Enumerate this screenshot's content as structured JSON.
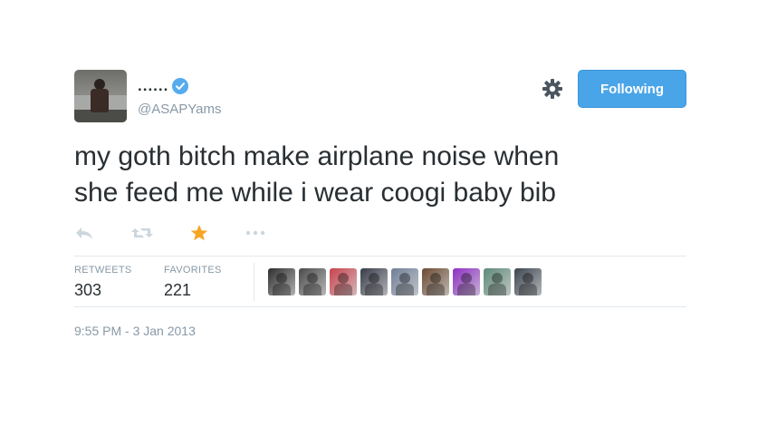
{
  "user": {
    "display_name": "......",
    "handle": "@ASAPYams",
    "verified": true
  },
  "follow_button": {
    "label": "Following"
  },
  "tweet": {
    "lines": [
      "my goth bitch make airplane noise when",
      "she feed me while i wear coogi baby bib"
    ],
    "timestamp": "9:55 PM - 3 Jan 2013"
  },
  "actions": [
    {
      "name": "reply-icon",
      "favorited": false
    },
    {
      "name": "retweet-icon",
      "favorited": false
    },
    {
      "name": "favorite-star-icon",
      "favorited": true
    },
    {
      "name": "more-options-icon",
      "favorited": false
    }
  ],
  "stats": {
    "retweets_label": "RETWEETS",
    "retweets_value": "303",
    "favorites_label": "FAVORITES",
    "favorites_value": "221"
  },
  "favoriters": [
    {
      "name": "favoriter-avatar-1",
      "color": "#2e2e2e"
    },
    {
      "name": "favoriter-avatar-2",
      "color": "#4a4a4a"
    },
    {
      "name": "favoriter-avatar-3",
      "color": "#c8434d"
    },
    {
      "name": "favoriter-avatar-4",
      "color": "#383c4a"
    },
    {
      "name": "favoriter-avatar-5",
      "color": "#6f7f96"
    },
    {
      "name": "favoriter-avatar-6",
      "color": "#6b4a32"
    },
    {
      "name": "favoriter-avatar-7",
      "color": "#8e2fc4"
    },
    {
      "name": "favoriter-avatar-8",
      "color": "#5d8a78"
    },
    {
      "name": "favoriter-avatar-9",
      "color": "#3c4550"
    }
  ],
  "colors": {
    "accent": "#55acee",
    "star": "#f6a623",
    "muted": "#8899a6",
    "text": "#292f33"
  }
}
